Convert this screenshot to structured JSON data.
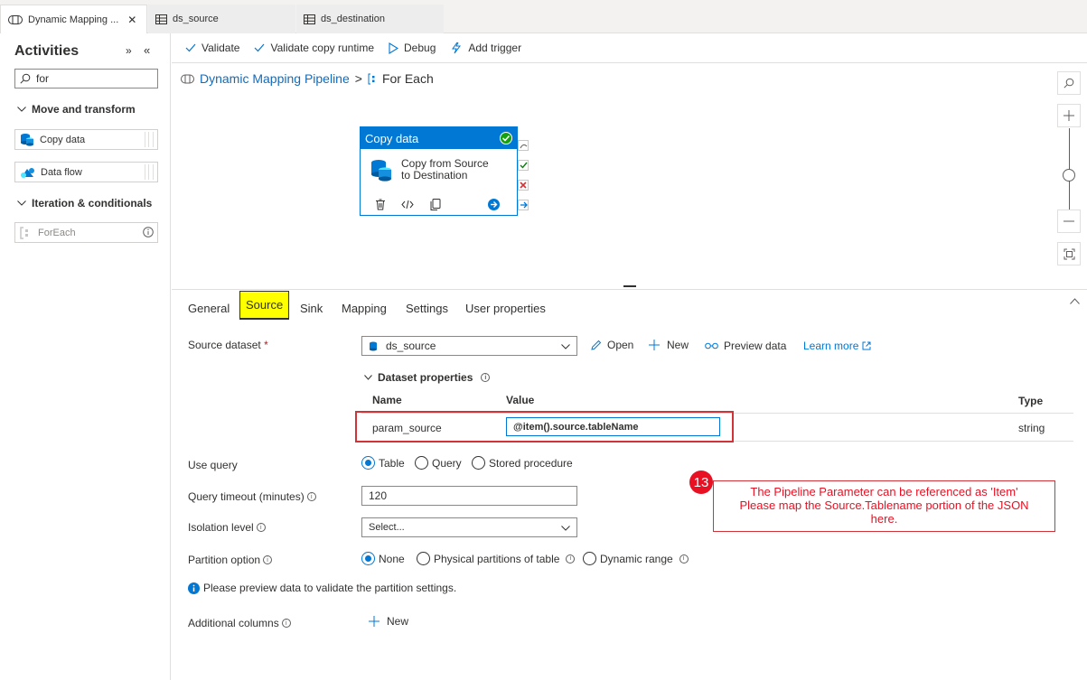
{
  "tabs": [
    {
      "label": "Dynamic Mapping ...",
      "active": true
    },
    {
      "label": "ds_source",
      "active": false
    },
    {
      "label": "ds_destination",
      "active": false
    }
  ],
  "left_panel": {
    "title": "Activities",
    "search_value": "for",
    "groups": [
      {
        "label": "Move and transform",
        "items": [
          "Copy data",
          "Data flow"
        ]
      },
      {
        "label": "Iteration & conditionals",
        "items": [
          "ForEach"
        ]
      }
    ]
  },
  "toolbar": {
    "validate": "Validate",
    "validate_copy": "Validate copy runtime",
    "debug": "Debug",
    "add_trigger": "Add trigger"
  },
  "breadcrumb": {
    "pipeline": "Dynamic Mapping Pipeline",
    "sep": ">",
    "current": "For Each"
  },
  "activity_card": {
    "header": "Copy data",
    "line1": "Copy from Source",
    "line2": "to Destination"
  },
  "prop_tabs": [
    "General",
    "Source",
    "Sink",
    "Mapping",
    "Settings",
    "User properties"
  ],
  "selected_tab": "Source",
  "source": {
    "dataset_label": "Source dataset",
    "required_mark": "*",
    "dataset_value": "ds_source",
    "open": "Open",
    "new": "New",
    "preview": "Preview data",
    "learn_more": "Learn more",
    "dataset_props": "Dataset properties",
    "col_name": "Name",
    "col_value": "Value",
    "col_type": "Type",
    "param_name": "param_source",
    "param_value": "@item().source.tableName",
    "param_type": "string",
    "use_query_label": "Use query",
    "use_query_options": [
      "Table",
      "Query",
      "Stored procedure"
    ],
    "timeout_label": "Query timeout (minutes)",
    "timeout_value": "120",
    "isolation_label": "Isolation level",
    "isolation_value": "Select...",
    "partition_label": "Partition option",
    "partition_options": [
      "None",
      "Physical partitions of table",
      "Dynamic range"
    ],
    "partition_note": "Please preview data to validate the partition settings.",
    "additional_label": "Additional columns",
    "additional_new": "New"
  },
  "callout": {
    "step": "13",
    "line1": "The Pipeline Parameter can be referenced as 'Item'",
    "line2": "Please map the Source.Tablename portion of the JSON",
    "line3": "here."
  },
  "colors": {
    "accent": "#0078d4",
    "highlight": "#ffff00",
    "callout_red": "#e81123"
  }
}
